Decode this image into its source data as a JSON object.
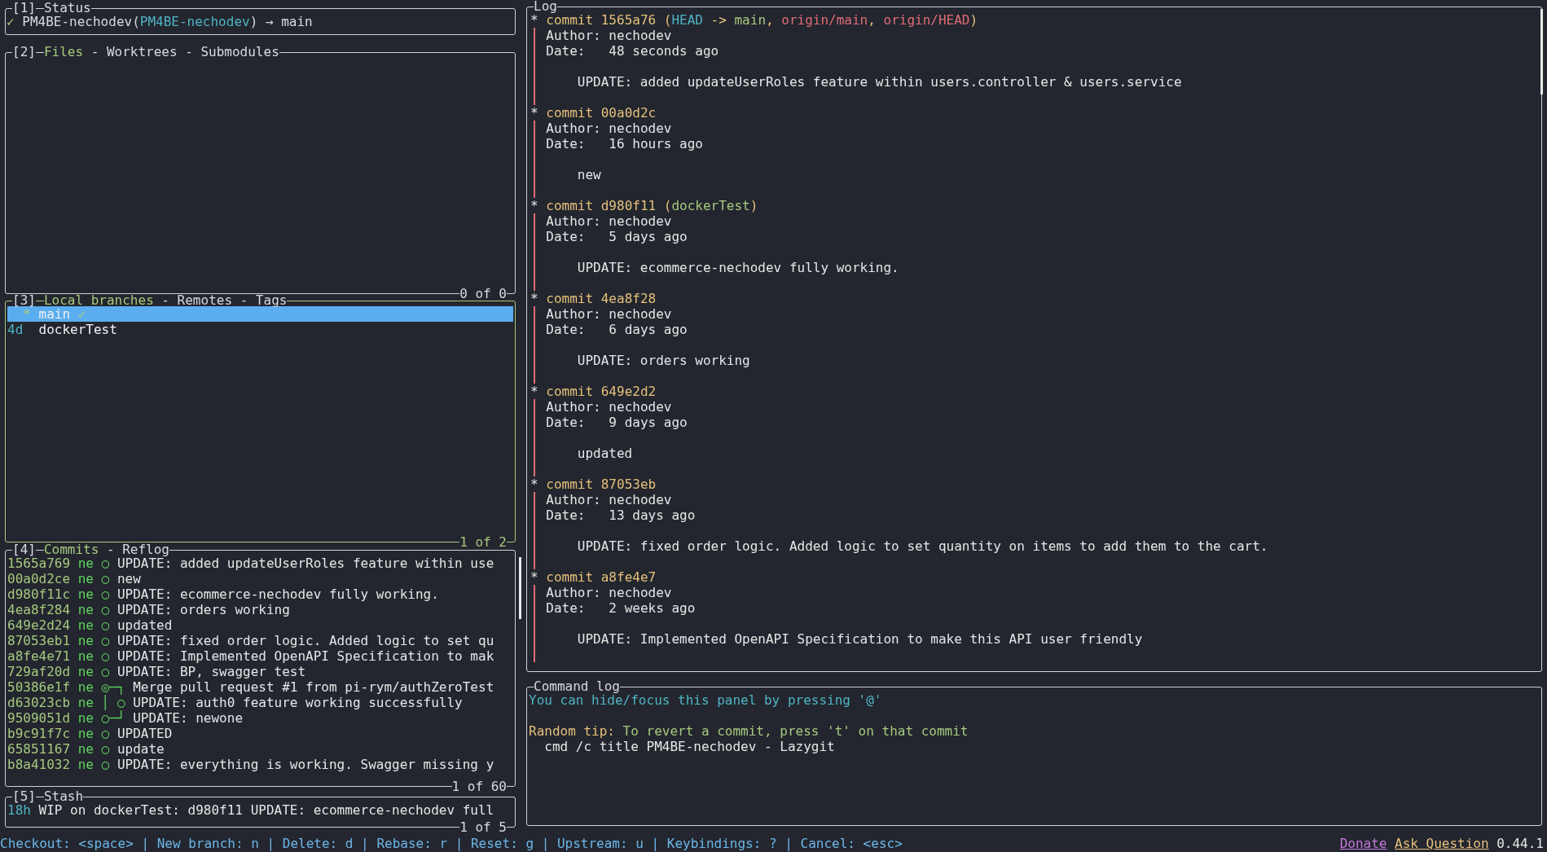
{
  "status_panel": {
    "number": "[1]",
    "title": "Status",
    "focused": false,
    "line": [
      {
        "text": "✓",
        "kind": "ok"
      },
      {
        "text": "PM4BE-nechodev(",
        "kind": "plain"
      },
      {
        "text": "PM4BE-nechodev",
        "kind": "accent"
      },
      {
        "text": ") → main",
        "kind": "plain"
      }
    ]
  },
  "files_panel": {
    "number": "[2]",
    "focused": false,
    "separator": "-",
    "counter": "0 of 0",
    "tabs": [
      {
        "label": "Files",
        "selected": true
      },
      {
        "label": "Worktrees",
        "selected": false
      },
      {
        "label": "Submodules",
        "selected": false
      }
    ]
  },
  "branches_panel": {
    "number": "[3]",
    "focused": true,
    "separator": "-",
    "counter": "1 of 2",
    "tabs": [
      {
        "label": "Local branches",
        "selected": true
      },
      {
        "label": "Remotes",
        "selected": false
      },
      {
        "label": "Tags",
        "selected": false
      }
    ],
    "branches": [
      {
        "kind": "current",
        "marker": "*",
        "name": "main",
        "badge": "✓",
        "selected": true
      },
      {
        "kind": "other",
        "age": "4d",
        "name": "dockerTest",
        "selected": false
      }
    ]
  },
  "commits_panel": {
    "number": "[4]",
    "focused": false,
    "separator": "-",
    "counter": "1 of 60",
    "tabs": [
      {
        "label": "Commits",
        "selected": true
      },
      {
        "label": "Reflog",
        "selected": false
      }
    ],
    "commits": [
      {
        "hash": "1565a769",
        "author": "ne",
        "graph": "○",
        "message": "UPDATE: added updateUserRoles feature within use"
      },
      {
        "hash": "00a0d2ce",
        "author": "ne",
        "graph": "○",
        "message": "new"
      },
      {
        "hash": "d980f11c",
        "author": "ne",
        "graph": "○",
        "message": "UPDATE: ecommerce-nechodev fully working."
      },
      {
        "hash": "4ea8f284",
        "author": "ne",
        "graph": "○",
        "message": "UPDATE: orders working"
      },
      {
        "hash": "649e2d24",
        "author": "ne",
        "graph": "○",
        "message": "updated"
      },
      {
        "hash": "87053eb1",
        "author": "ne",
        "graph": "○",
        "message": "UPDATE: fixed order logic. Added logic to set qu"
      },
      {
        "hash": "a8fe4e71",
        "author": "ne",
        "graph": "○",
        "message": "UPDATE: Implemented OpenAPI Specification to mak"
      },
      {
        "hash": "729af20d",
        "author": "ne",
        "graph": "○",
        "message": "UPDATE: BP, swagger test"
      },
      {
        "hash": "50386e1f",
        "author": "ne",
        "graph": "◎─┐",
        "message": "Merge pull request #1 from pi-rym/authZeroTest"
      },
      {
        "hash": "d63023cb",
        "author": "ne",
        "graph": "│ ○",
        "message": "UPDATE: auth0 feature working successfully"
      },
      {
        "hash": "9509051d",
        "author": "ne",
        "graph": "○─┘",
        "message": "UPDATE: newone"
      },
      {
        "hash": "b9c91f7c",
        "author": "ne",
        "graph": "○",
        "message": "UPDATED"
      },
      {
        "hash": "65851167",
        "author": "ne",
        "graph": "○",
        "message": "update"
      },
      {
        "hash": "b8a41032",
        "author": "ne",
        "graph": "○",
        "message": "UPDATE: everything is working. Swagger missing y"
      }
    ]
  },
  "stash_panel": {
    "number": "[5]",
    "title": "Stash",
    "focused": false,
    "counter": "1 of 5",
    "entries": [
      {
        "age": "18h",
        "message": "WIP on dockerTest: d980f11 UPDATE: ecommerce-nechodev full"
      }
    ]
  },
  "log_panel": {
    "title": "Log",
    "focused": false,
    "entries": [
      {
        "node": "*",
        "commit": "commit 1565a76",
        "refs": [
          {
            "text": " (",
            "kind": "punct"
          },
          {
            "text": "HEAD",
            "kind": "head"
          },
          {
            "text": " -> ",
            "kind": "punct"
          },
          {
            "text": "main",
            "kind": "local"
          },
          {
            "text": ", ",
            "kind": "punct"
          },
          {
            "text": "origin/main",
            "kind": "remote"
          },
          {
            "text": ", ",
            "kind": "punct"
          },
          {
            "text": "origin/HEAD",
            "kind": "remote"
          },
          {
            "text": ")",
            "kind": "punct"
          }
        ],
        "author": "Author: nechodev",
        "date": "Date:   48 seconds ago",
        "message": "UPDATE: added updateUserRoles feature within users.controller & users.service"
      },
      {
        "node": "*",
        "commit": "commit 00a0d2c",
        "author": "Author: nechodev",
        "date": "Date:   16 hours ago",
        "message": "new"
      },
      {
        "node": "*",
        "commit": "commit d980f11",
        "refs": [
          {
            "text": " (",
            "kind": "punct"
          },
          {
            "text": "dockerTest",
            "kind": "local"
          },
          {
            "text": ")",
            "kind": "punct"
          }
        ],
        "author": "Author: nechodev",
        "date": "Date:   5 days ago",
        "message": "UPDATE: ecommerce-nechodev fully working."
      },
      {
        "node": "*",
        "commit": "commit 4ea8f28",
        "author": "Author: nechodev",
        "date": "Date:   6 days ago",
        "message": "UPDATE: orders working"
      },
      {
        "node": "*",
        "commit": "commit 649e2d2",
        "author": "Author: nechodev",
        "date": "Date:   9 days ago",
        "message": "updated"
      },
      {
        "node": "*",
        "commit": "commit 87053eb",
        "author": "Author: nechodev",
        "date": "Date:   13 days ago",
        "message": "UPDATE: fixed order logic. Added logic to set quantity on items to add them to the cart."
      },
      {
        "node": "*",
        "commit": "commit a8fe4e7",
        "author": "Author: nechodev",
        "date": "Date:   2 weeks ago",
        "message": "UPDATE: Implemented OpenAPI Specification to make this API user friendly"
      }
    ]
  },
  "command_log_panel": {
    "title": "Command log",
    "focused": false,
    "lines": [
      {
        "kind": "info",
        "text": "You can hide/focus this panel by pressing '@'"
      },
      {
        "kind": "blank"
      },
      {
        "kind": "tip",
        "label": "Random tip:",
        "text": "To revert a commit, press 't' on that commit"
      },
      {
        "kind": "command",
        "text": "cmd /c title PM4BE-nechodev - Lazygit"
      }
    ]
  },
  "bottom_bar": {
    "keybindings": "Checkout: <space> | New branch: n | Delete: d | Rebase: r | Reset: g | Upstream: u | Keybindings: ? | Cancel: <esc>",
    "links": [
      {
        "label": "Donate",
        "kind": "donate"
      },
      {
        "label": "Ask Question",
        "kind": "ask"
      }
    ],
    "version": "0.44.1"
  }
}
